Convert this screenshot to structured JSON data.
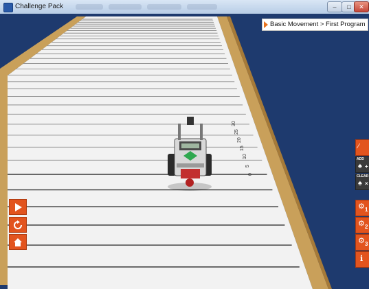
{
  "window": {
    "title": "Challenge Pack",
    "controls": [
      "minimize",
      "maximize",
      "close"
    ]
  },
  "breadcrumb": {
    "text": "Basic Movement > First Program"
  },
  "track": {
    "ruler_labels": [
      "0",
      "5",
      "10",
      "15",
      "20",
      "25",
      "30"
    ]
  },
  "left_controls": [
    {
      "name": "play-button",
      "icon": "play-icon"
    },
    {
      "name": "reset-button",
      "icon": "reset-icon"
    },
    {
      "name": "home-button",
      "icon": "home-icon"
    }
  ],
  "right_controls": [
    {
      "name": "graph-button",
      "label": "",
      "icon": "graph-icon",
      "number": ""
    },
    {
      "name": "add-button",
      "label": "ADD",
      "icon": "robot-add-icon",
      "number": ""
    },
    {
      "name": "clear-button",
      "label": "CLEAR",
      "icon": "robot-clear-icon",
      "number": ""
    },
    {
      "name": "challenge-1-button",
      "label": "",
      "icon": "robot-icon",
      "number": "1"
    },
    {
      "name": "challenge-2-button",
      "label": "",
      "icon": "robot-icon",
      "number": "2"
    },
    {
      "name": "challenge-3-button",
      "label": "",
      "icon": "robot-icon",
      "number": "3"
    },
    {
      "name": "info-button",
      "label": "",
      "icon": "info-icon",
      "number": ""
    }
  ],
  "colors": {
    "accent": "#e2541e",
    "backdrop": "#1e3a6e",
    "track": "#f2f2f2",
    "rail": "#c9a05a"
  }
}
